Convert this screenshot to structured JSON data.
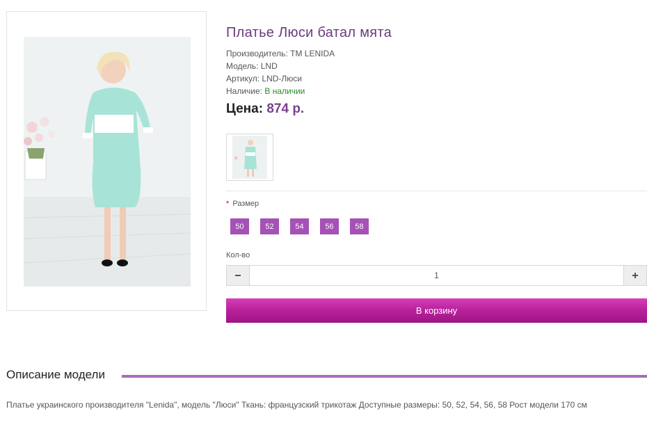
{
  "product": {
    "title": "Платье Люси батал мята",
    "info": [
      {
        "label": "Производитель:",
        "value": "TM LENIDA"
      },
      {
        "label": "Модель:",
        "value": "LND"
      },
      {
        "label": "Артикул:",
        "value": "LND-Люси"
      },
      {
        "label": "Наличие:",
        "value": "В наличии"
      }
    ],
    "price_label": "Цена:",
    "price_value": "874 р."
  },
  "options": {
    "required_mark": "*",
    "size_label": "Размер",
    "sizes": [
      "50",
      "52",
      "54",
      "56",
      "58"
    ]
  },
  "quantity": {
    "label": "Кол-во",
    "value": "1",
    "minus_icon": "minus-icon",
    "plus_icon": "plus-icon"
  },
  "cart_button": "В корзину",
  "description": {
    "heading": "Описание модели",
    "text": "Платье украинского производителя \"Lenida\", модель \"Люси\" Ткань: французский трикотаж Доступные размеры: 50, 52, 54, 56, 58 Рост модели 170 см"
  },
  "colors": {
    "title": "#6b3a7d",
    "price": "#7a3f8f",
    "size_chip": "#a551b5",
    "cart_button": "#b8209b",
    "in_stock": "#2a8a2a",
    "description_rule": "#a66db8",
    "dress": "#a8e3d8"
  }
}
